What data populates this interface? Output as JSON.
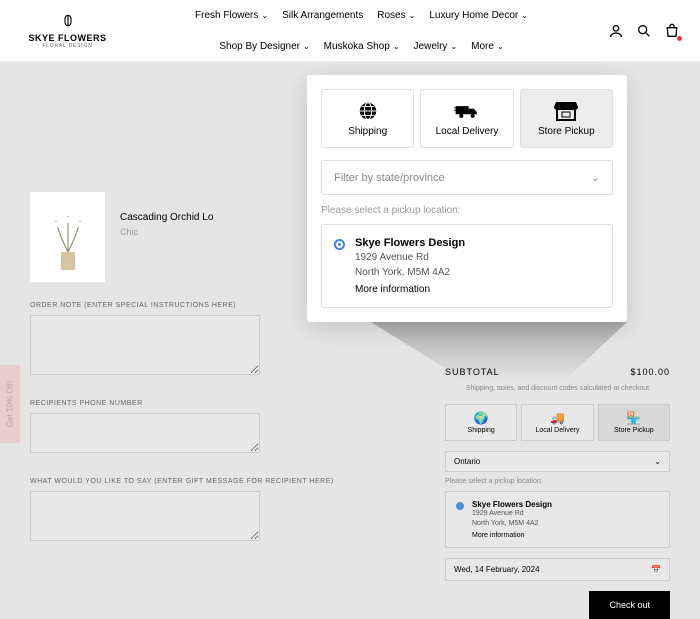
{
  "brand": {
    "name": "SKYE FLOWERS",
    "tagline": "FLORAL DESIGN"
  },
  "nav": {
    "row1": [
      "Fresh Flowers",
      "Silk Arrangements",
      "Roses",
      "Luxury Home Decor"
    ],
    "row2": [
      "Shop By Designer",
      "Muskoka Shop",
      "Jewelry",
      "More"
    ]
  },
  "promo": {
    "label": "Get 10% Off!"
  },
  "product": {
    "title": "Cascading Orchid Lo",
    "sub": "Chic"
  },
  "form": {
    "order_note_label": "ORDER NOTE (ENTER SPECIAL INSTRUCTIONS HERE)",
    "phone_label": "RECIPIENTS PHONE NUMBER",
    "message_label": "WHAT WOULD YOU LIKE TO SAY (ENTER GIFT MESSAGE FOR RECIPIENT HERE)"
  },
  "cart": {
    "subtotal_label": "SUBTOTAL",
    "subtotal_value": "$100.00",
    "ship_note": "Shipping, taxes, and discount codes calculated at checkout",
    "checkout": "Check out"
  },
  "shipping": {
    "tabs": {
      "shipping": "Shipping",
      "local": "Local Delivery",
      "pickup": "Store Pickup"
    },
    "filter_placeholder": "Filter by state/province",
    "province_selected": "Ontario",
    "pickup_prompt": "Please select a pickup location:",
    "date_value": "Wed, 14 February, 2024"
  },
  "location": {
    "name": "Skye Flowers Design",
    "addr1": "1929 Avenue Rd",
    "addr2": "North York, M5M 4A2",
    "more": "More information"
  }
}
